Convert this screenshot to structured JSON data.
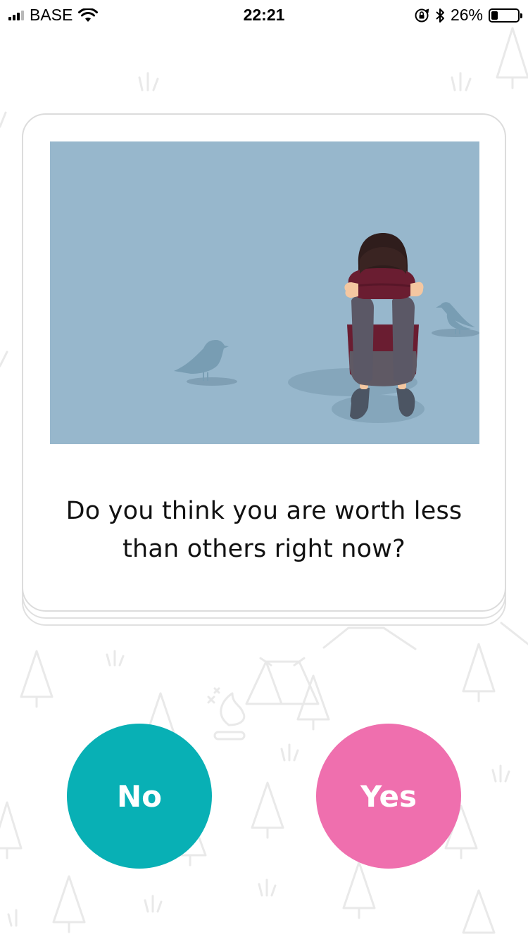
{
  "status_bar": {
    "carrier": "BASE",
    "time": "22:21",
    "battery_text": "26%",
    "battery_level": 0.26,
    "icons": [
      "signal-icon",
      "wifi-icon",
      "rotation-lock-icon",
      "bluetooth-icon",
      "battery-icon"
    ]
  },
  "card": {
    "question": "Do you think you are worth less than others right now?"
  },
  "buttons": {
    "no_label": "No",
    "yes_label": "Yes"
  },
  "colors": {
    "no_button": "#08b0b5",
    "yes_button": "#ef6fae",
    "illustration_bg": "#97b7cc",
    "doodle": "#ececec"
  }
}
